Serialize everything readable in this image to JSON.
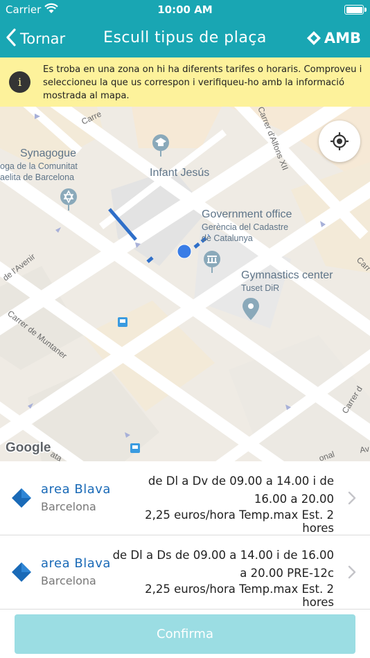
{
  "status_bar": {
    "carrier": "Carrier",
    "time": "10:00 AM"
  },
  "nav": {
    "back_label": "Tornar",
    "title": "Escull tipus de plaça",
    "logo_text": "AMB"
  },
  "banner": {
    "text": "Es troba en una zona on hi ha diferents tarifes o horaris. Comproveu i seleccioneu la que us correspon i verifiqueu-ho amb la informació mostrada al mapa."
  },
  "map": {
    "labels": {
      "synagogue": "Synagogue",
      "synagogue_sub1": "oga de la Comunitat",
      "synagogue_sub2": "aelita de Barcelona",
      "infant_jesus": "Infant Jesús",
      "government_office": "Government office",
      "gov_sub1": "Gerència del Cadastre",
      "gov_sub2": "de Catalunya",
      "gymnastics_center": "Gymnastics center",
      "gym_sub": "Tuset DiR",
      "street_avenir": "de l'Avenir",
      "street_muntaner": "Carrer de Muntaner",
      "street_alfons": "Carrer d'Alfons XII",
      "street_top": "Carre",
      "street_right1": "Carr",
      "street_right2": "Carrer d",
      "street_bottom_right": "Av",
      "street_bottom_mid": "onal",
      "street_bottom_left": "ata"
    },
    "google_logo": "Google"
  },
  "zones": [
    {
      "name": "area Blava",
      "city": "Barcelona",
      "schedule": "de Dl a Dv de 09.00 a 14.00 i de 16.00 a 20.00",
      "rate": "2,25 euros/hora Temp.max Est. 2 hores"
    },
    {
      "name": "area Blava",
      "city": "Barcelona",
      "schedule": "de Dl a Ds de 09.00 a 14.00 i de 16.00 a 20.00 PRE-12c",
      "rate": "2,25 euros/hora Temp.max Est. 2 hores"
    }
  ],
  "confirm_label": "Confirma",
  "colors": {
    "teal": "#19a6b3",
    "banner_yellow": "#fdf29b",
    "zone_blue": "#1a6ab7",
    "confirm_disabled": "#9bdde3"
  }
}
